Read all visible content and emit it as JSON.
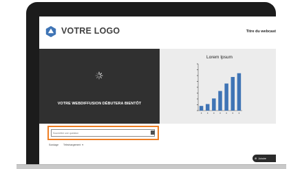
{
  "header": {
    "logo_text": "VOTRE LOGO",
    "webcast_title": "Titre du webcast"
  },
  "player": {
    "message": "VOTRE WEBDIFFUSION DÉBUTERA BIENTÔT"
  },
  "slide": {
    "title": "Lorem Ipsum"
  },
  "chart_data": {
    "type": "bar",
    "title": "Lorem Ipsum",
    "categories": [
      "",
      "",
      "",
      "",
      "",
      "",
      ""
    ],
    "values": [
      10,
      14,
      26,
      42,
      58,
      72,
      80
    ],
    "ylim": [
      0,
      100
    ],
    "colors": [
      "#3f74b5"
    ],
    "grid": false
  },
  "question": {
    "placeholder": "Soumettre une question",
    "send_icon": "send-icon",
    "highlight_color": "#ee7d22"
  },
  "tabs": [
    {
      "label": "Sondage"
    },
    {
      "label": "Téléchargement"
    }
  ],
  "join": {
    "label": "Joindre"
  },
  "colors": {
    "bezel": "#1c1c1c",
    "player_bg": "#303030",
    "slide_bg": "#ececec",
    "logo_accent": "#3f74b5",
    "bar": "#3f74b5"
  }
}
